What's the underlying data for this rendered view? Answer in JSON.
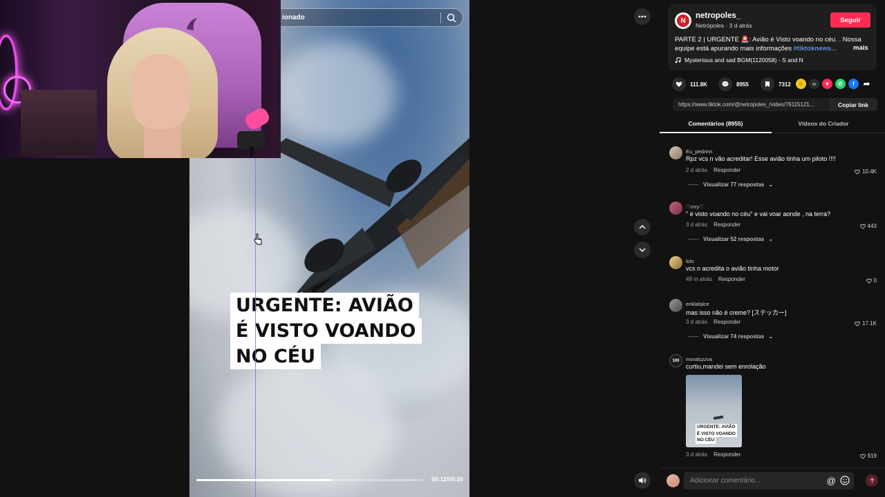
{
  "search": {
    "value": "ionado"
  },
  "video": {
    "caption_lines": [
      "URGENTE: AVIÃO",
      "É VISTO VOANDO",
      "NO CÉU"
    ],
    "time": "00:12/00:20",
    "progress": 0.6
  },
  "post": {
    "logo_letter": "N",
    "author": "netropoles_",
    "author_sub": "Netrópoles · 3 d atrás",
    "follow_label": "Seguir",
    "desc_text": "PARTE 2 | URGENTE 🚨: Avião é Visto voando no céu. . Nossa equipe está apurando mais informações ",
    "desc_hashtag": "#tiktoknews...",
    "more_label": "mais",
    "music": "Mysterious and sad BGM(1120058) - S and N"
  },
  "stats": {
    "likes": "111.8K",
    "comments": "8955",
    "saves": "7312"
  },
  "share_icons": [
    "gold-coin-icon",
    "embed-icon",
    "tiktok-friends-icon",
    "whatsapp-icon",
    "facebook-icon",
    "share-arrow-icon"
  ],
  "link": {
    "url": "https://www.tiktok.com/@netropoles_/video/76115121...",
    "copy_label": "Copiar link"
  },
  "tabs": {
    "comments": "Comentários (8955)",
    "creator": "Vídeos do Criador"
  },
  "comments": [
    {
      "user": "Eu_pedrinn",
      "text": "Rpz vcs n vão acreditar! Esse avião tinha um piloto !!!!",
      "time": "2 d atrás",
      "reply": "Responder",
      "likes": "10.4K",
      "more": "Visualizar 77 respostas"
    },
    {
      "user": "♡mry♡",
      "text": "\" é visto voando no céu\" e vai voar aonde , na terra?",
      "time": "3 d atrás",
      "reply": "Responder",
      "likes": "443",
      "more": "Visualizar 52 respostas"
    },
    {
      "user": "lolo",
      "text": "vcs n acredita o avião tinha motor",
      "time": "49 m atrás",
      "reply": "Responder",
      "likes": "0"
    },
    {
      "user": "eriklafalce",
      "text": "mas isso não é creme? [ステッカー]",
      "time": "3 d atrás",
      "reply": "Responder",
      "likes": "17.1K",
      "more": "Visualizar 74 respostas"
    },
    {
      "user": "moralszzva",
      "text": "curtiu,mandei sem enrolação",
      "time": "3 d atrás",
      "reply": "Responder",
      "likes": "919",
      "thumb_caption": [
        "URGENTE: AVIÃO",
        "É VISTO VOANDO",
        "NO CÉU"
      ],
      "avatar_badge": "100"
    }
  ],
  "comment_input": {
    "placeholder": "Adicionar comentário..."
  },
  "colors": {
    "accent": "#fe2c55",
    "hashtag": "#5b8ee6",
    "panel_bg": "#121212"
  }
}
